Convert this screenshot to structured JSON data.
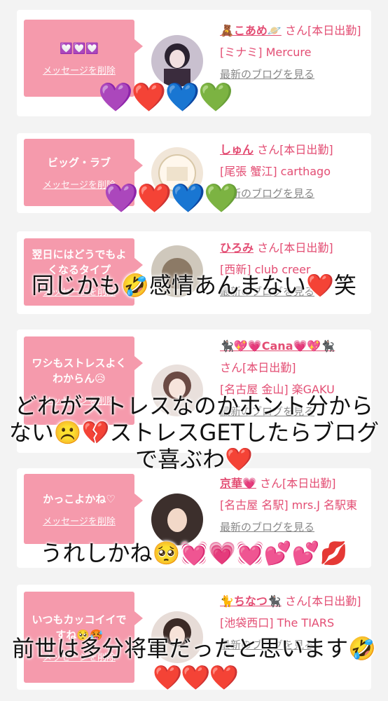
{
  "delete_label": "メッセージを削除",
  "blog_label": "最新のブログを見る",
  "cards": [
    {
      "message": "💟💟💟",
      "name": "🧸こあめ🪐",
      "suffix": "さん[本日出勤]",
      "shop": "[ミナミ] Mercure",
      "overlay": "",
      "hearts": "💜❤️💙💚"
    },
    {
      "message": "ビッグ・ラブ",
      "name": "しゅん",
      "suffix": "さん[本日出勤]",
      "shop": "[尾張 蟹江] carthago",
      "overlay": "",
      "hearts": "💜❤️💙💚"
    },
    {
      "message": "翌日にはどうでもよくなるタイプ",
      "name": "ひろみ",
      "suffix": "さん[本日出勤]",
      "shop": "[西新] club creer",
      "overlay": "同じかも🤣感情あんまない❤️笑",
      "hearts": ""
    },
    {
      "message": "ワシもストレスよくわからん😥",
      "name": "🐈‍⬛💖💗Cana💗💖🐈‍⬛",
      "suffix": "さん[本日出勤]",
      "shop": "[名古屋 金山] 楽GAKU",
      "overlay": "どれがストレスなのかホント分からない☹️💔ストレスGETしたらブログで喜ぶわ❤️",
      "hearts": ""
    },
    {
      "message": "かっこよかね♡",
      "name": "京華💗",
      "suffix": "さん[本日出勤]",
      "shop": "[名古屋 名駅] mrs.J 名駅東",
      "overlay": "うれしかね🥺💓💗💓💕💕💋",
      "hearts": ""
    },
    {
      "message": "いつもカッコイイですね🥺🥵",
      "name": "🐈ちなつ🐈‍⬛",
      "suffix": "さん[本日出勤]",
      "shop": "[池袋西口] The TIARS",
      "overlay": "前世は多分将軍だったと思います🤣",
      "hearts": "❤️❤️❤️"
    }
  ],
  "colors": {
    "accent": "#e34d73",
    "bubble": "#f59aac",
    "background": "#f3f3f3"
  }
}
